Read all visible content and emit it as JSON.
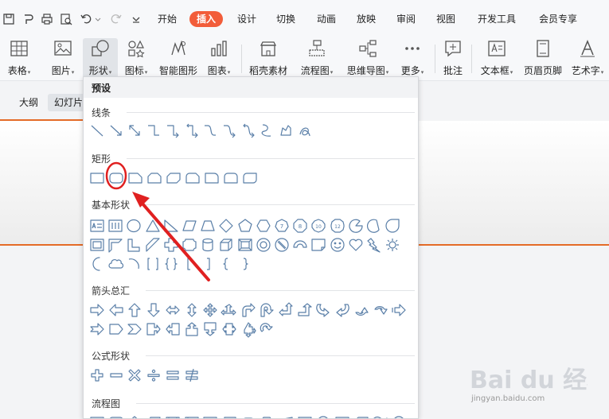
{
  "menu": {
    "tabs": [
      "开始",
      "插入",
      "设计",
      "切换",
      "动画",
      "放映",
      "审阅",
      "视图",
      "开发工具",
      "会员专享"
    ],
    "active": "插入"
  },
  "ribbon": {
    "table": "表格",
    "picture": "图片",
    "shape": "形状",
    "icon": "图标",
    "smart_shape": "智能图形",
    "chart": "图表",
    "material": "稻壳素材",
    "flowchart": "流程图",
    "mindmap": "思维导图",
    "more": "更多",
    "comment": "批注",
    "textbox": "文本框",
    "header_footer": "页眉页脚",
    "wordart": "艺术字"
  },
  "view_tabs": {
    "outline": "大纲",
    "slides": "幻灯片"
  },
  "shape_panel": {
    "header": "预设",
    "sections": {
      "lines": "线条",
      "rectangles": "矩形",
      "basic": "基本形状",
      "arrows": "箭头总汇",
      "formula": "公式形状",
      "flowchart": "流程图"
    }
  },
  "watermark": {
    "logo": "Bai du 经验",
    "url": "jingyan.baidu.com"
  },
  "colors": {
    "accent": "#f25d3a",
    "shape_stroke": "#5a7fa8",
    "annotation": "#e02020"
  }
}
